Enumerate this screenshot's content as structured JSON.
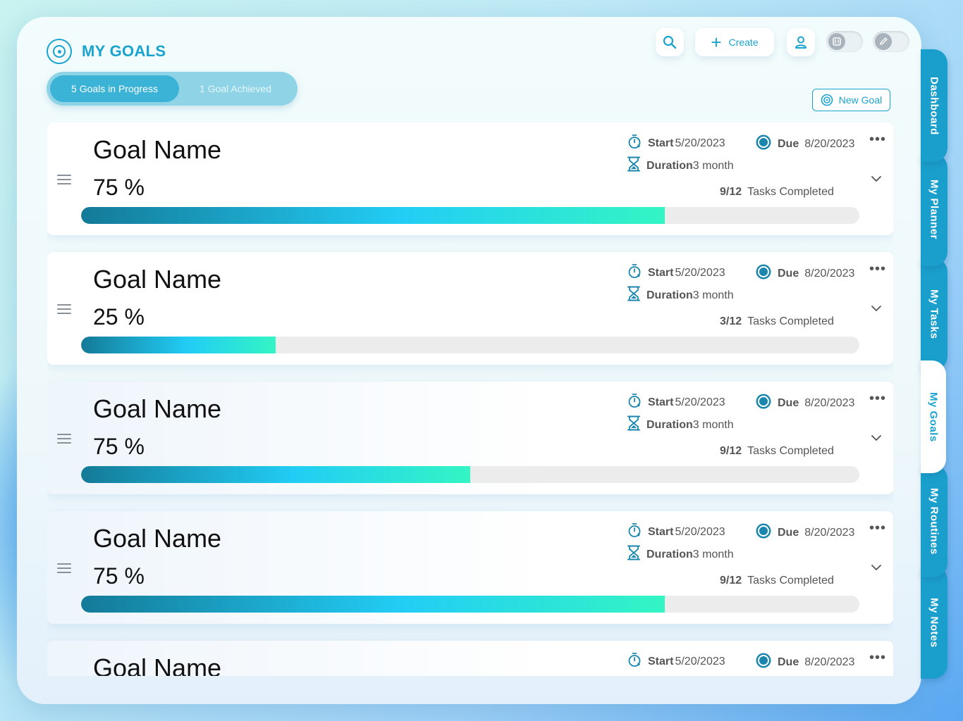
{
  "header": {
    "title": "MY GOALS",
    "segments": [
      {
        "label": "5 Goals in Progress",
        "active": true
      },
      {
        "label": "1 Goal Achieved",
        "active": false
      }
    ],
    "create_label": "Create",
    "new_goal_label": "New Goal"
  },
  "tabs": [
    {
      "label": "Dashboard"
    },
    {
      "label": "My Planner"
    },
    {
      "label": "My Tasks"
    },
    {
      "label": "My Goals",
      "active": true
    },
    {
      "label": "My Routines"
    },
    {
      "label": "My Notes"
    }
  ],
  "goals": [
    {
      "name": "Goal Name",
      "percent_label": "75 %",
      "progress": 0.75,
      "start_label": "Start",
      "start": "5/20/2023",
      "due_label": "Due",
      "due": "8/20/2023",
      "duration_label": "Duration",
      "duration": "3 month",
      "tasks_count": "9/12",
      "tasks_label": "Tasks Completed"
    },
    {
      "name": "Goal Name",
      "percent_label": "25 %",
      "progress": 0.25,
      "start_label": "Start",
      "start": "5/20/2023",
      "due_label": "Due",
      "due": "8/20/2023",
      "duration_label": "Duration",
      "duration": "3 month",
      "tasks_count": "3/12",
      "tasks_label": "Tasks Completed"
    },
    {
      "name": "Goal Name",
      "percent_label": "75 %",
      "progress": 0.5,
      "start_label": "Start",
      "start": "5/20/2023",
      "due_label": "Due",
      "due": "8/20/2023",
      "duration_label": "Duration",
      "duration": "3 month",
      "tasks_count": "9/12",
      "tasks_label": "Tasks Completed"
    },
    {
      "name": "Goal Name",
      "percent_label": "75 %",
      "progress": 0.75,
      "start_label": "Start",
      "start": "5/20/2023",
      "due_label": "Due",
      "due": "8/20/2023",
      "duration_label": "Duration",
      "duration": "3 month",
      "tasks_count": "9/12",
      "tasks_label": "Tasks Completed"
    },
    {
      "name": "Goal Name",
      "percent_label": "",
      "progress": 0,
      "start_label": "Start",
      "start": "5/20/2023",
      "due_label": "Due",
      "due": "8/20/2023",
      "duration_label": "",
      "duration": "",
      "tasks_count": "",
      "tasks_label": ""
    }
  ],
  "colors": {
    "accent": "#1aa3cf",
    "progress_start": "#147a98",
    "progress_mid": "#22cdf5",
    "progress_end": "#33f5c4"
  }
}
